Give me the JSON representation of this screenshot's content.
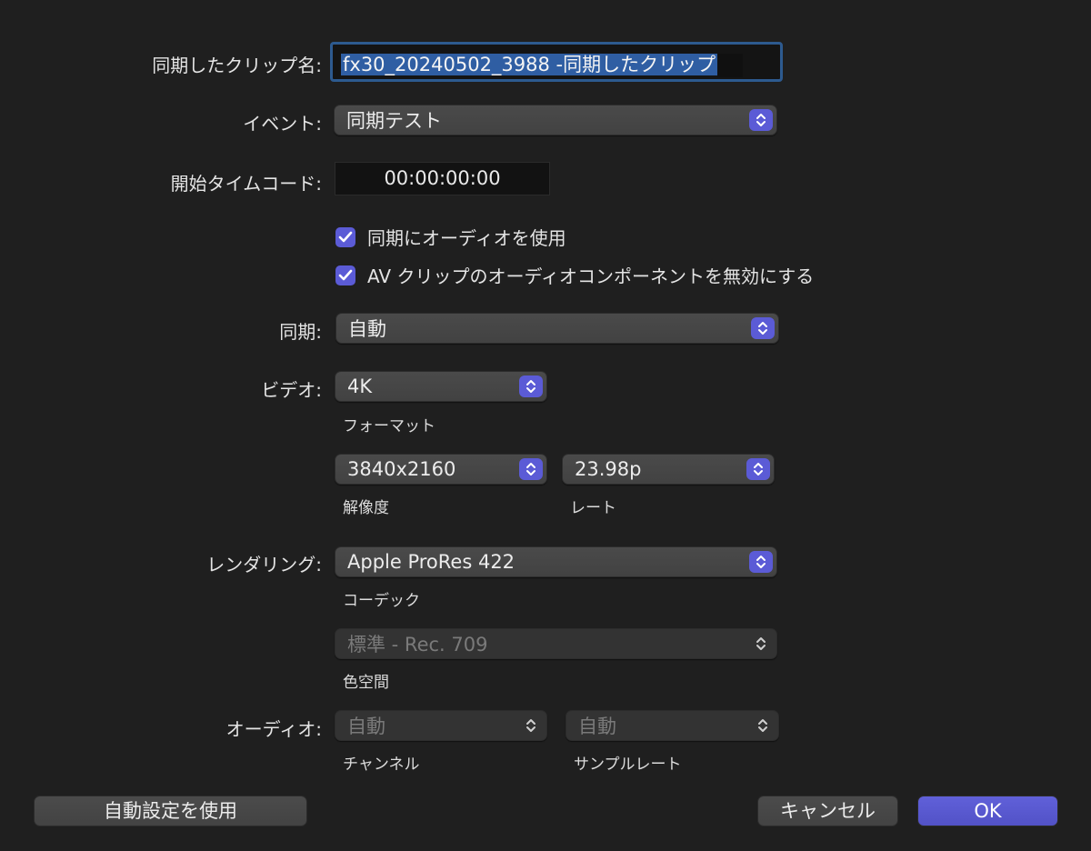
{
  "labels": {
    "clip_name": "同期したクリップ名:",
    "event": "イベント:",
    "start_timecode": "開始タイムコード:",
    "sync": "同期:",
    "video": "ビデオ:",
    "rendering": "レンダリング:",
    "audio": "オーディオ:"
  },
  "clip_name_value": "fx30_20240502_3988 -同期したクリップ",
  "event_value": "同期テスト",
  "start_timecode_value": "00:00:00:00",
  "checkboxes": [
    {
      "label": "同期にオーディオを使用",
      "checked": true
    },
    {
      "label": "AV クリップのオーディオコンポーネントを無効にする",
      "checked": true
    }
  ],
  "sync_value": "自動",
  "video": {
    "format_value": "4K",
    "format_label": "フォーマット",
    "resolution_value": "3840x2160",
    "resolution_label": "解像度",
    "rate_value": "23.98p",
    "rate_label": "レート"
  },
  "rendering": {
    "codec_value": "Apple ProRes 422",
    "codec_label": "コーデック",
    "color_space_value": "標準 - Rec. 709",
    "color_space_label": "色空間"
  },
  "audio": {
    "channels_value": "自動",
    "channels_label": "チャンネル",
    "sample_rate_value": "自動",
    "sample_rate_label": "サンプルレート"
  },
  "buttons": {
    "auto_settings": "自動設定を使用",
    "cancel": "キャンセル",
    "ok": "OK"
  },
  "colors": {
    "accent": "#5b5bd6",
    "selection": "#2f5ea3",
    "background": "#1f1f1f"
  },
  "icons": {
    "popup_stepper": "chevron-up-down-icon",
    "check": "checkmark-icon"
  }
}
